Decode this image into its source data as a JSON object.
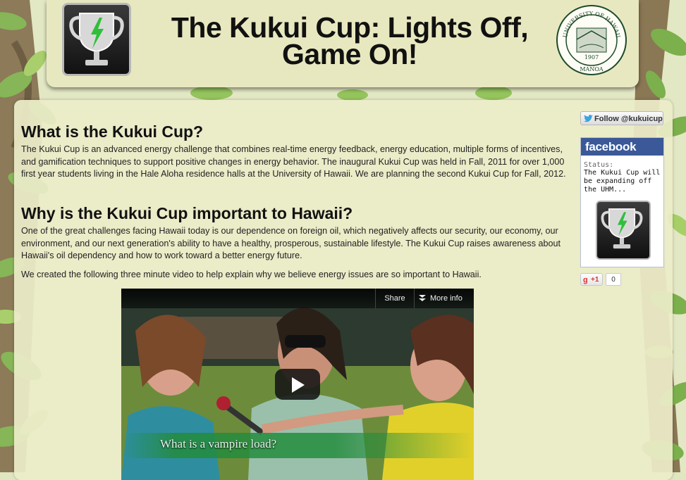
{
  "header": {
    "title": "The Kukui Cup: Lights Off, Game On!",
    "seal_text_top": "UNIVERSITY OF HAWAII",
    "seal_year": "1907",
    "seal_text_bottom": "MANOA"
  },
  "main": {
    "sections": [
      {
        "heading": "What is the Kukui Cup?",
        "paragraphs": [
          "The Kukui Cup is an advanced energy challenge that combines real-time energy feedback, energy education, multiple forms of incentives, and gamification techniques to support positive changes in energy behavior. The inaugural Kukui Cup was held in Fall, 2011 for over 1,000 first year students living in the Hale Aloha residence halls at the University of Hawaii. We are planning the second Kukui Cup for Fall, 2012."
        ]
      },
      {
        "heading": "Why is the Kukui Cup important to Hawaii?",
        "paragraphs": [
          "One of the great challenges facing Hawaii today is our dependence on foreign oil, which negatively affects our security, our economy, our environment, and our next generation's ability to have a healthy, prosperous, sustainable lifestyle. The Kukui Cup raises awareness about Hawaii's oil dependency and how to work toward a better energy future.",
          "We created the following three minute video to help explain why we believe energy issues are so important to Hawaii."
        ]
      }
    ],
    "video": {
      "share_label": "Share",
      "more_info_label": "More info",
      "caption": "What is a vampire load?"
    }
  },
  "sidebar": {
    "twitter_follow_label": "Follow @kukuicup",
    "facebook": {
      "brand": "facebook",
      "status_label": "Status:",
      "status_text": "The Kukui Cup will be expanding off the UHM..."
    },
    "gplus_label": "+1",
    "gplus_count": "0"
  },
  "colors": {
    "facebook_blue": "#3b5998",
    "lightning_green": "#2fbf3a",
    "panel_bg": "#ececc8"
  },
  "icons": [
    "trophy-logo-icon",
    "university-seal-icon",
    "twitter-bird-icon",
    "play-icon",
    "more-info-icon",
    "google-plus-icon"
  ]
}
